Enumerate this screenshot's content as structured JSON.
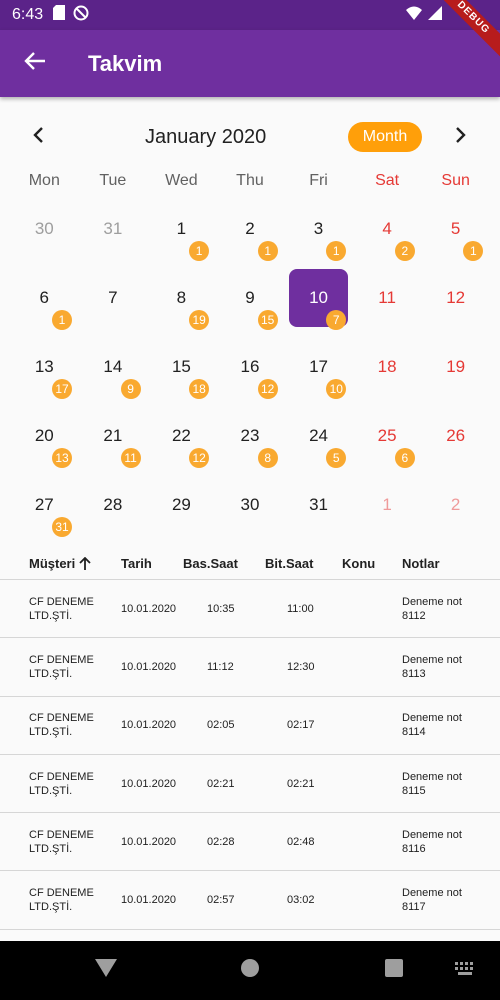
{
  "status": {
    "time": "6:43"
  },
  "app_bar": {
    "title": "Takvim",
    "debug_label": "DEBUG"
  },
  "calendar": {
    "month_title": "January 2020",
    "format_button": "Month",
    "weekdays": [
      {
        "label": "Mon",
        "weekend": false
      },
      {
        "label": "Tue",
        "weekend": false
      },
      {
        "label": "Wed",
        "weekend": false
      },
      {
        "label": "Thu",
        "weekend": false
      },
      {
        "label": "Fri",
        "weekend": false
      },
      {
        "label": "Sat",
        "weekend": true
      },
      {
        "label": "Sun",
        "weekend": true
      }
    ],
    "weeks": [
      [
        {
          "day": "30",
          "outside": true,
          "badge": ""
        },
        {
          "day": "31",
          "outside": true,
          "badge": ""
        },
        {
          "day": "1",
          "badge": "1"
        },
        {
          "day": "2",
          "badge": "1"
        },
        {
          "day": "3",
          "badge": "1"
        },
        {
          "day": "4",
          "badge": "2"
        },
        {
          "day": "5",
          "badge": "1"
        }
      ],
      [
        {
          "day": "6",
          "badge": "1"
        },
        {
          "day": "7",
          "badge": ""
        },
        {
          "day": "8",
          "badge": "19"
        },
        {
          "day": "9",
          "badge": "15"
        },
        {
          "day": "10",
          "badge": "7",
          "selected": true
        },
        {
          "day": "11",
          "badge": ""
        },
        {
          "day": "12",
          "badge": ""
        }
      ],
      [
        {
          "day": "13",
          "badge": "17"
        },
        {
          "day": "14",
          "badge": "9"
        },
        {
          "day": "15",
          "badge": "18"
        },
        {
          "day": "16",
          "badge": "12"
        },
        {
          "day": "17",
          "badge": "10"
        },
        {
          "day": "18",
          "badge": ""
        },
        {
          "day": "19",
          "badge": ""
        }
      ],
      [
        {
          "day": "20",
          "badge": "13"
        },
        {
          "day": "21",
          "badge": "11"
        },
        {
          "day": "22",
          "badge": "12"
        },
        {
          "day": "23",
          "badge": "8"
        },
        {
          "day": "24",
          "badge": "5"
        },
        {
          "day": "25",
          "badge": "6"
        },
        {
          "day": "26",
          "badge": ""
        }
      ],
      [
        {
          "day": "27",
          "badge": "31"
        },
        {
          "day": "28",
          "badge": ""
        },
        {
          "day": "29",
          "badge": ""
        },
        {
          "day": "30",
          "badge": ""
        },
        {
          "day": "31",
          "badge": ""
        },
        {
          "day": "1",
          "outside": true,
          "badge": ""
        },
        {
          "day": "2",
          "outside": true,
          "badge": ""
        }
      ]
    ]
  },
  "table": {
    "headers": [
      "Müşteri",
      "Tarih",
      "Bas.Saat",
      "Bit.Saat",
      "Konu",
      "Notlar"
    ],
    "sorted_column": "Müşteri",
    "rows": [
      {
        "musteri": "CF DENEME LTD.ŞTİ.",
        "tarih": "10.01.2020",
        "bas": "10:35",
        "bit": "11:00",
        "konu": "",
        "notlar": "Deneme not 8112"
      },
      {
        "musteri": "CF DENEME LTD.ŞTİ.",
        "tarih": "10.01.2020",
        "bas": "11:12",
        "bit": "12:30",
        "konu": "",
        "notlar": "Deneme not 8113"
      },
      {
        "musteri": "CF DENEME LTD.ŞTİ.",
        "tarih": "10.01.2020",
        "bas": "02:05",
        "bit": "02:17",
        "konu": "",
        "notlar": "Deneme not 8114"
      },
      {
        "musteri": "CF DENEME LTD.ŞTİ.",
        "tarih": "10.01.2020",
        "bas": "02:21",
        "bit": "02:21",
        "konu": "",
        "notlar": "Deneme not 8115"
      },
      {
        "musteri": "CF DENEME LTD.ŞTİ.",
        "tarih": "10.01.2020",
        "bas": "02:28",
        "bit": "02:48",
        "konu": "",
        "notlar": "Deneme not 8116"
      },
      {
        "musteri": "CF DENEME LTD.ŞTİ.",
        "tarih": "10.01.2020",
        "bas": "02:57",
        "bit": "03:02",
        "konu": "",
        "notlar": "Deneme not 8117"
      }
    ]
  },
  "colors": {
    "app_bar": "#6f2f9f",
    "status_bar": "#5b2389",
    "accent": "#ff9f0a",
    "badge": "#f9a930",
    "weekend": "#e53935",
    "selected_day": "#6f2f9f"
  },
  "icons": {
    "back": "arrow-left-icon",
    "prev": "chevron-left-icon",
    "next": "chevron-right-icon",
    "sort": "arrow-up-icon"
  }
}
